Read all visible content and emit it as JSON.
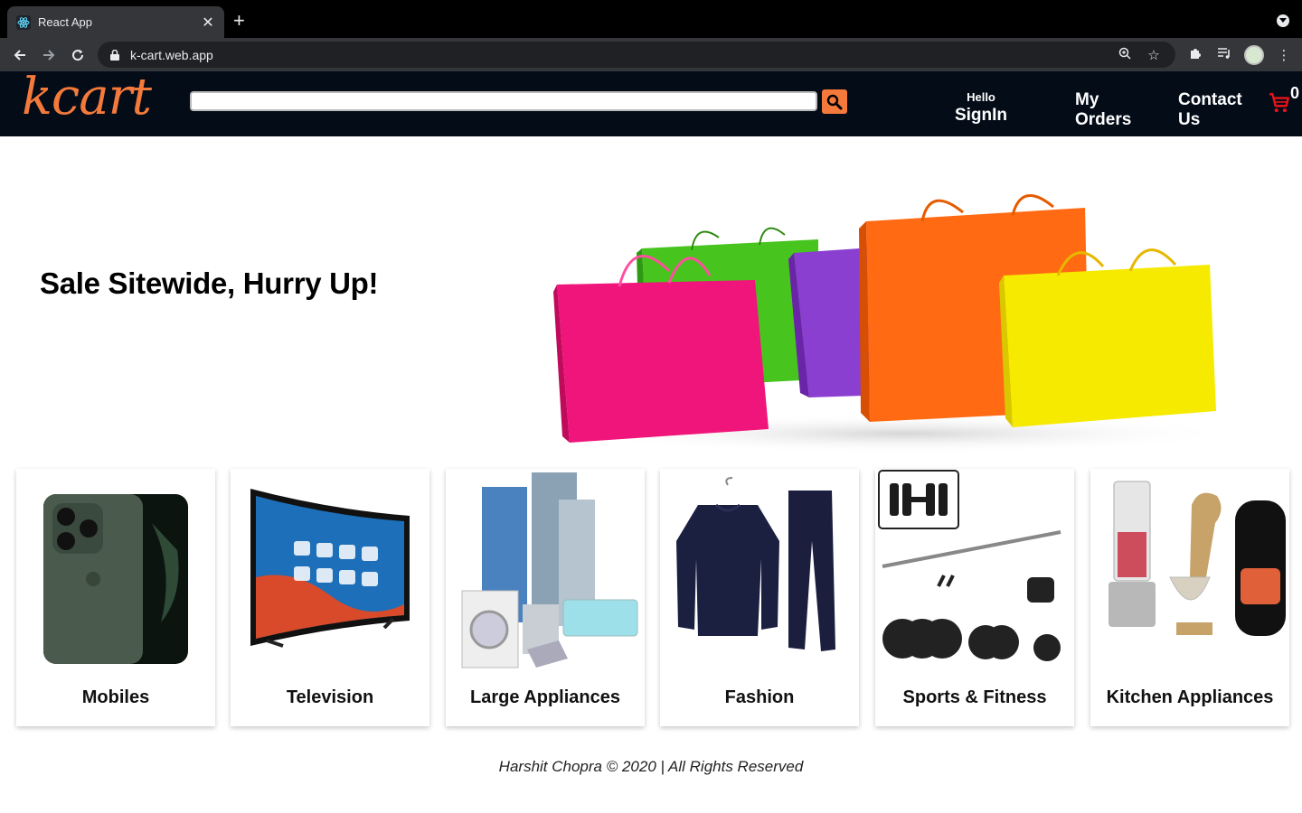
{
  "browser": {
    "tab_title": "React App",
    "url": "k-cart.web.app"
  },
  "header": {
    "logo_text": "kcart",
    "search_placeholder": "",
    "signin_small": "Hello",
    "signin_big": "SignIn",
    "orders_line1": "My",
    "orders_line2": "Orders",
    "contact_line1": "Contact",
    "contact_line2": "Us",
    "cart_count": "0"
  },
  "hero": {
    "headline": "Sale Sitewide, Hurry Up!"
  },
  "categories": [
    {
      "label": "Mobiles",
      "icon": "phone-image"
    },
    {
      "label": "Television",
      "icon": "tv-image"
    },
    {
      "label": "Large Appliances",
      "icon": "appliances-image"
    },
    {
      "label": "Fashion",
      "icon": "fashion-image"
    },
    {
      "label": "Sports & Fitness",
      "icon": "fitness-image"
    },
    {
      "label": "Kitchen Appliances",
      "icon": "kitchen-image"
    }
  ],
  "footer": {
    "text": "Harshit Chopra © 2020 | All Rights Reserved"
  },
  "colors": {
    "accent": "#f47a3b",
    "header_bg": "#040c18",
    "cart_red": "#e8121a"
  }
}
